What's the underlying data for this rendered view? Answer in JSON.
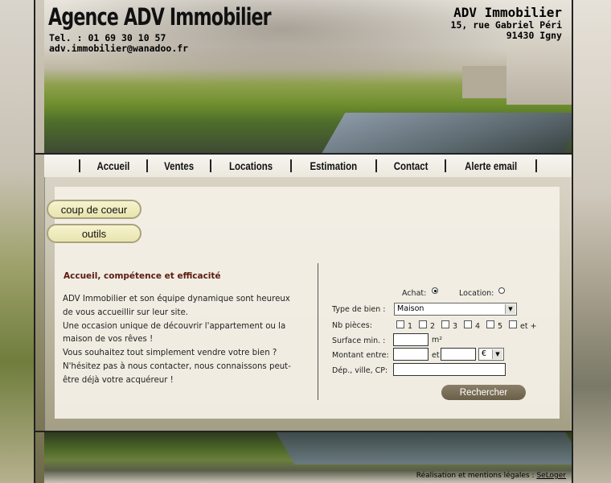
{
  "header": {
    "title": "Agence ADV Immobilier",
    "tel": "Tel. : 01 69 30 10 57",
    "email": "adv.immobilier@wanadoo.fr",
    "company": "ADV Immobilier",
    "street": "15, rue Gabriel Péri",
    "city": "91430 Igny"
  },
  "nav": {
    "items": [
      "Accueil",
      "Ventes",
      "Locations",
      "Estimation",
      "Contact",
      "Alerte email"
    ]
  },
  "side_buttons": {
    "coup_de_coeur": "coup de coeur",
    "outils": "outils"
  },
  "main": {
    "section_title": "Accueil, compétence et efficacité",
    "paragraph_lines": [
      "ADV Immobilier et son équipe dynamique sont heureux",
      "de vous accueillir sur leur site.",
      "Une occasion unique de découvrir l'appartement ou la",
      "maison de vos rêves !",
      "Vous souhaitez tout simplement vendre votre bien ?",
      "N'hésitez pas à nous contacter, nous connaissons peut-",
      "être déjà votre acquéreur !"
    ]
  },
  "search": {
    "achat_label": "Achat:",
    "location_label": "Location:",
    "achat_selected": true,
    "type_label": "Type de bien :",
    "type_value": "Maison",
    "pieces_label": "Nb pièces:",
    "pieces_options": [
      "1",
      "2",
      "3",
      "4",
      "5",
      "et +"
    ],
    "surface_label": "Surface min. :",
    "surface_unit": "m²",
    "montant_label": "Montant entre:",
    "montant_et": "et",
    "currency_value": "€",
    "dep_label": "Dép., ville, CP:",
    "button_label": "Rechercher"
  },
  "footer": {
    "text": "Réalisation et mentions légales :",
    "link": "SeLoger"
  }
}
